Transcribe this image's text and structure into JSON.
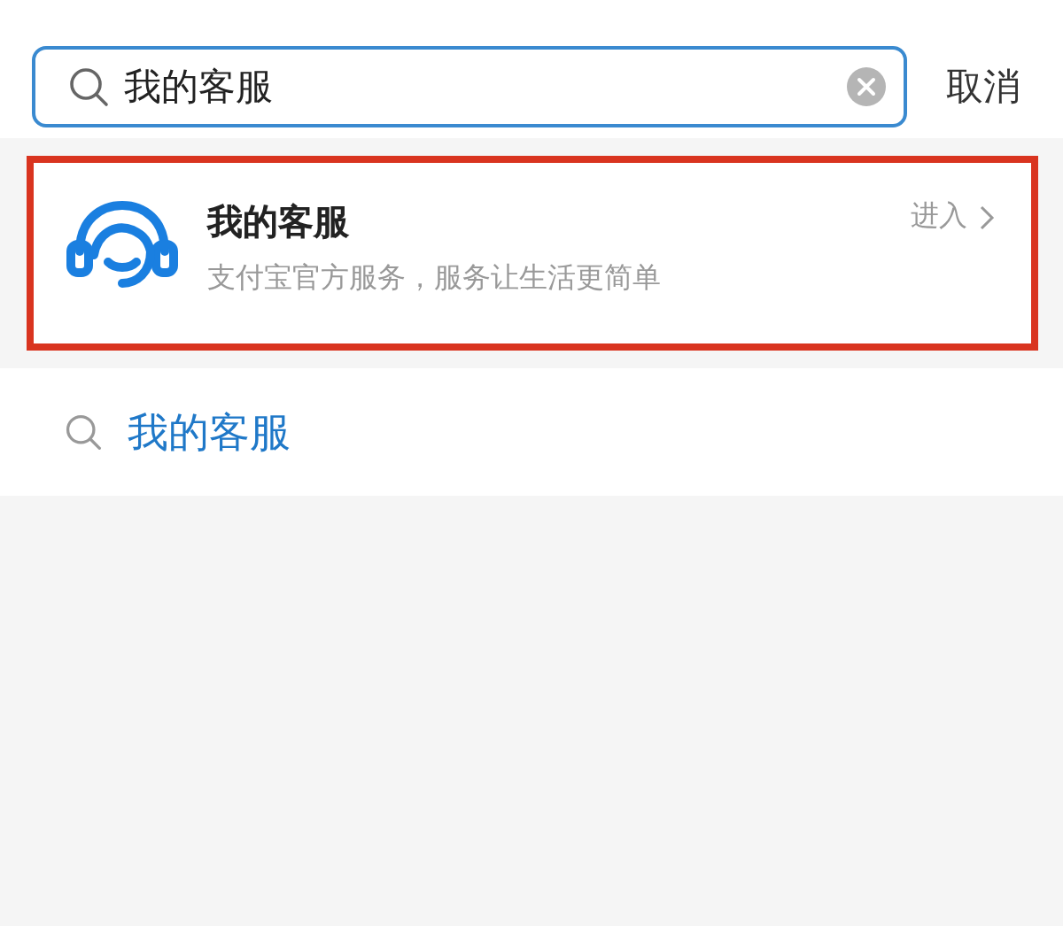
{
  "search": {
    "value": "我的客服",
    "cancel": "取消"
  },
  "result": {
    "title": "我的客服",
    "subtitle": "支付宝官方服务，服务让生活更简单",
    "action": "进入",
    "highlighted": true
  },
  "suggestion": {
    "text": "我的客服"
  }
}
